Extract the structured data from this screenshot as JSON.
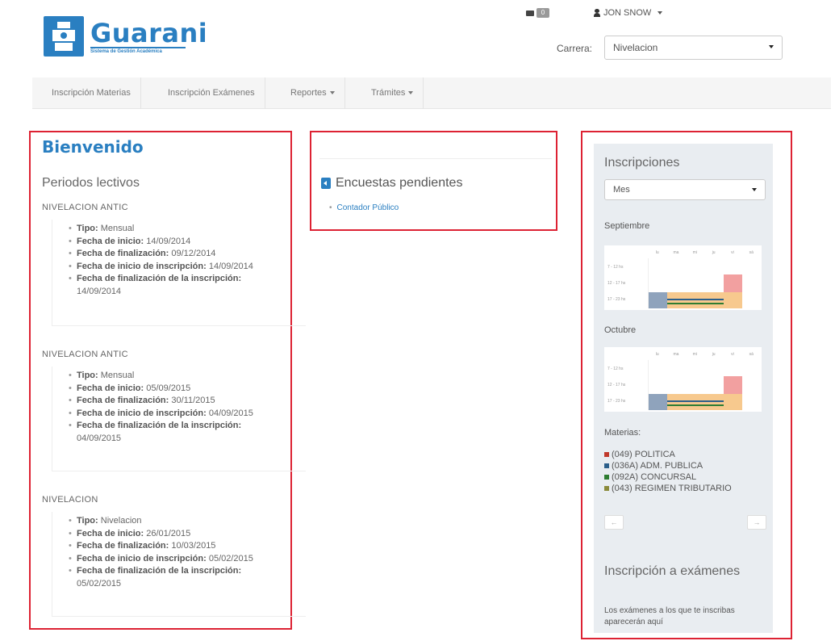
{
  "header": {
    "logo_title": "Guarani",
    "logo_subtitle": "Sistema de Gestión Académica",
    "mail_count": "0",
    "user_name": "JON SNOW",
    "carrera_label": "Carrera:",
    "carrera_value": "Nivelacion"
  },
  "nav": {
    "items": [
      {
        "label": "Inscripción Materias"
      },
      {
        "label": "Inscripción Exámenes"
      },
      {
        "label": "Reportes"
      },
      {
        "label": "Trámites"
      }
    ]
  },
  "welcome": {
    "title": "Bienvenido",
    "periodos_title": "Periodos lectivos",
    "periods": [
      {
        "name": "NIVELACION ANTIC",
        "tipo_label": "Tipo:",
        "tipo": "Mensual",
        "inicio_label": "Fecha de inicio:",
        "inicio": "14/09/2014",
        "fin_label": "Fecha de finalización:",
        "fin": "09/12/2014",
        "insc_inicio_label": "Fecha de inicio de inscripción:",
        "insc_inicio": "14/09/2014",
        "insc_fin_label": "Fecha de finalización de la inscripción:",
        "insc_fin": "14/09/2014"
      },
      {
        "name": "NIVELACION ANTIC",
        "tipo_label": "Tipo:",
        "tipo": "Mensual",
        "inicio_label": "Fecha de inicio:",
        "inicio": "05/09/2015",
        "fin_label": "Fecha de finalización:",
        "fin": "30/11/2015",
        "insc_inicio_label": "Fecha de inicio de inscripción:",
        "insc_inicio": "04/09/2015",
        "insc_fin_label": "Fecha de finalización de la inscripción:",
        "insc_fin": "04/09/2015"
      },
      {
        "name": "NIVELACION",
        "tipo_label": "Tipo:",
        "tipo": "Nivelacion",
        "inicio_label": "Fecha de inicio:",
        "inicio": "26/01/2015",
        "fin_label": "Fecha de finalización:",
        "fin": "10/03/2015",
        "insc_inicio_label": "Fecha de inicio de inscripción:",
        "insc_inicio": "05/02/2015",
        "insc_fin_label": "Fecha de finalización de la inscripción:",
        "insc_fin": "05/02/2015"
      }
    ]
  },
  "encuestas": {
    "title": "Encuestas pendientes",
    "items": [
      {
        "label": "Contador Público"
      }
    ]
  },
  "inscripciones": {
    "title": "Inscripciones",
    "mode_value": "Mes",
    "calendar_days": [
      "lu",
      "ma",
      "mi",
      "ju",
      "vi",
      "sá"
    ],
    "time_slots": [
      "7 - 12 hs",
      "12 - 17 hs",
      "17 - 23 hs"
    ],
    "months": [
      {
        "name": "Septiembre"
      },
      {
        "name": "Octubre"
      }
    ],
    "materias_title": "Materias:",
    "materias": [
      {
        "label": "(049) POLITICA",
        "color": "#c0392b"
      },
      {
        "label": "(036A) ADM. PUBLICA",
        "color": "#2c5f8a"
      },
      {
        "label": "(092A) CONCURSAL",
        "color": "#2e7d32"
      },
      {
        "label": "(043) REGIMEN TRIBUTARIO",
        "color": "#8a8a3a"
      }
    ],
    "prev_label": "←",
    "next_label": "→",
    "examenes_title": "Inscripción a exámenes",
    "examenes_text": "Los exámenes a los que te inscribas aparecerán aquí"
  },
  "colors": {
    "accent": "#2a7fc1",
    "highlight": "#dd2233",
    "cal_blue": "#8fa3bc",
    "cal_red": "#f2a0a0",
    "cal_orange": "#f7c98e"
  }
}
